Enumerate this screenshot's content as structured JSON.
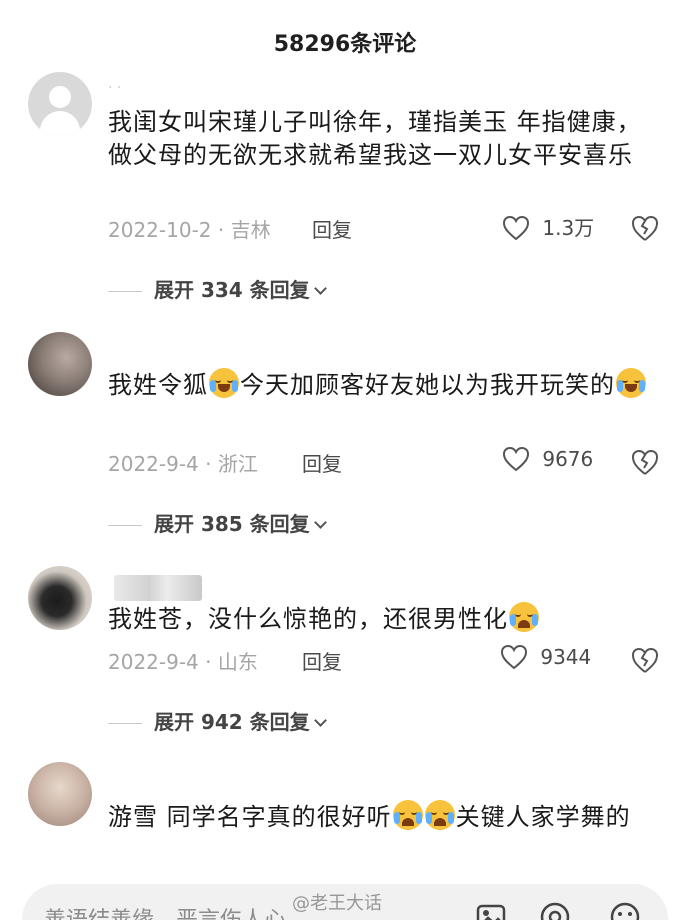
{
  "header": {
    "title": "58296条评论"
  },
  "comments": [
    {
      "username": "",
      "text": "我闺女叫宋瑾儿子叫徐年，瑾指美玉 年指健康，做父母的无欲无求就希望我这一双儿女平安喜乐",
      "date_location": "2022-10-2 · 吉林",
      "reply_label": "回复",
      "likes": "1.3万",
      "expand_label": "展开 334 条回复"
    },
    {
      "text_before": "我姓令狐",
      "text_after": "今天加顾客好友她以为我开玩笑的",
      "date_location": "2022-9-4 · 浙江",
      "reply_label": "回复",
      "likes": "9676",
      "expand_label": "展开 385 条回复"
    },
    {
      "text": "我姓苍，没什么惊艳的，还很男性化",
      "date_location": "2022-9-4 · 山东",
      "reply_label": "回复",
      "likes": "9344",
      "expand_label": "展开 942 条回复"
    },
    {
      "text_before": "游雪 同学名字真的很好听",
      "text_after": "关键人家学舞的"
    }
  ],
  "input": {
    "placeholder": "善语结善缘，恶言伤人心"
  },
  "watermark": "@老王大话",
  "icons": {
    "like": "heart-outline-icon",
    "dislike": "broken-heart-icon",
    "emoji_laugh_cry": "laugh-cry-emoji",
    "emoji_cry": "crying-emoji"
  }
}
